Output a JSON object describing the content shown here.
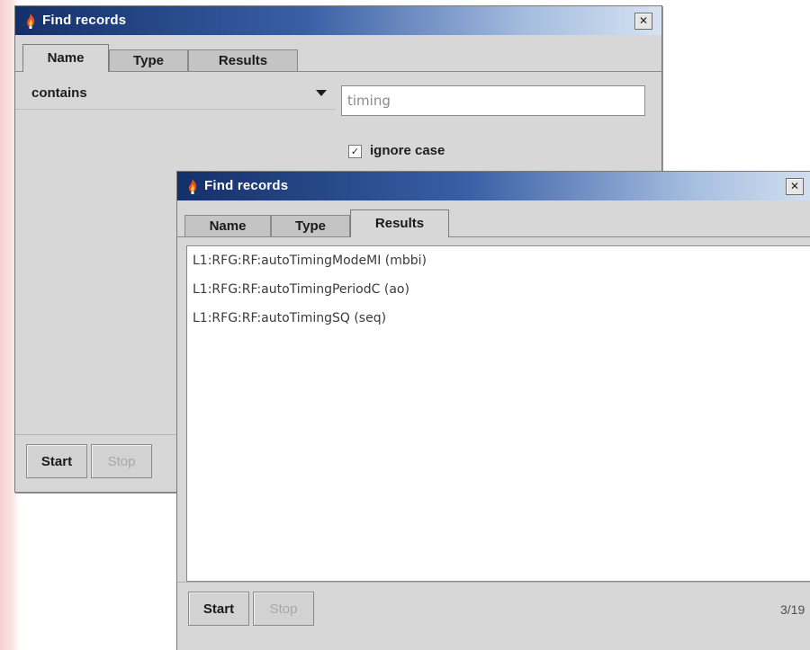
{
  "back_window": {
    "title": "Find records",
    "close_label": "✕",
    "tabs": [
      {
        "label": "Name",
        "active": true
      },
      {
        "label": "Type",
        "active": false
      },
      {
        "label": "Results",
        "active": false
      }
    ],
    "match_mode": "contains",
    "search_value": "timing",
    "ignore_case_checked": true,
    "ignore_case_label": "ignore case",
    "start_label": "Start",
    "stop_label": "Stop"
  },
  "front_window": {
    "title": "Find records",
    "close_label": "✕",
    "tabs": [
      {
        "label": "Name",
        "active": false
      },
      {
        "label": "Type",
        "active": false
      },
      {
        "label": "Results",
        "active": true
      }
    ],
    "results": [
      "L1:RFG:RF:autoTimingModeMI (mbbi)",
      "L1:RFG:RF:autoTimingPeriodC (ao)",
      "L1:RFG:RF:autoTimingSQ (seq)"
    ],
    "start_label": "Start",
    "stop_label": "Stop",
    "status_count": "3/19"
  },
  "colors": {
    "titlebar_start": "#14306a",
    "titlebar_end": "#d6e2f1",
    "window_bg": "#d7d7d7",
    "disabled_text": "#a8a8a8"
  },
  "icons": {
    "title_icon": "flame-icon",
    "close_icon": "close-icon",
    "dropdown_icon": "chevron-down-icon",
    "check_icon": "checkmark-icon"
  }
}
